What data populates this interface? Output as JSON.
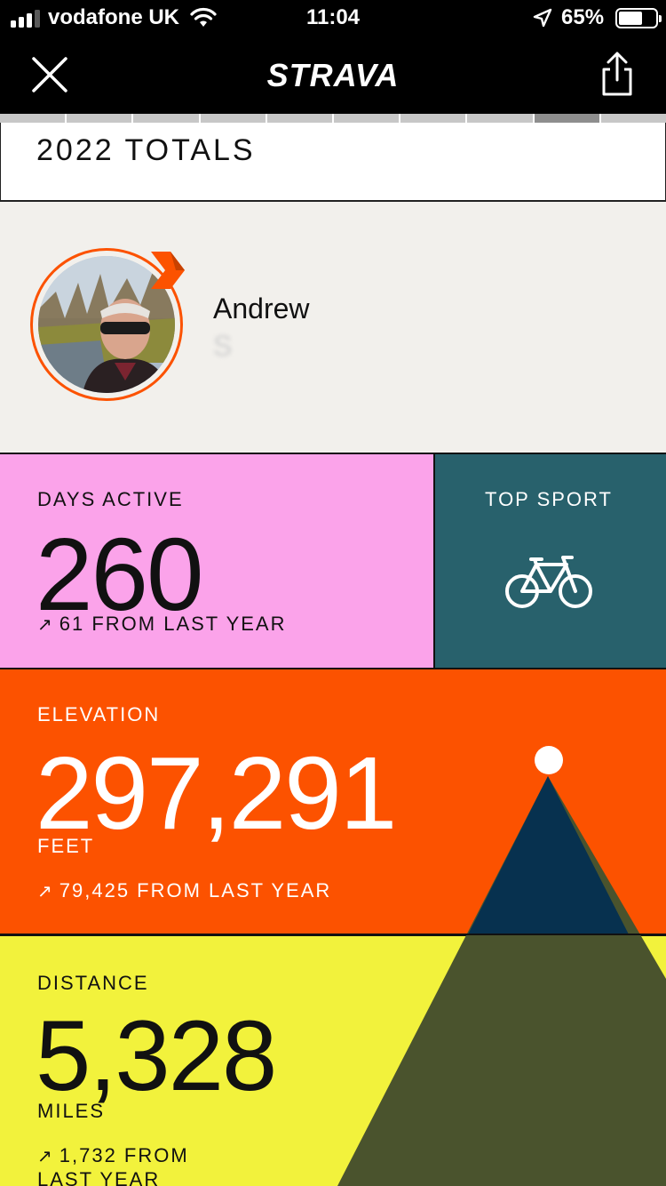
{
  "status_bar": {
    "carrier": "vodafone UK",
    "time": "11:04",
    "battery_percent": "65%",
    "battery_level": 0.65
  },
  "nav": {
    "logo": "STRAVA",
    "close_icon": "close-icon",
    "share_icon": "share-icon"
  },
  "story_progress": {
    "segments": 10,
    "current": 9
  },
  "card_title": "2022 TOTALS",
  "profile": {
    "first_name": "Andrew",
    "last_name_obscured": "S",
    "badge_color": "#fc5200"
  },
  "days_active": {
    "label": "DAYS ACTIVE",
    "value": "260",
    "delta": "61 FROM LAST YEAR",
    "arrow": "↗"
  },
  "top_sport": {
    "label": "TOP SPORT",
    "icon": "bicycle-icon"
  },
  "elevation": {
    "label": "ELEVATION",
    "value": "297,291",
    "unit": "FEET",
    "delta": "79,425 FROM LAST YEAR",
    "arrow": "↗"
  },
  "distance": {
    "label": "DISTANCE",
    "value": "5,328",
    "unit": "MILES",
    "delta": "1,732 FROM LAST YEAR",
    "arrow": "↗"
  },
  "colors": {
    "strava_orange": "#fc5200",
    "days_pink": "#fba3ea",
    "sport_teal": "#28616c",
    "distance_yellow": "#f2f23c",
    "mountain_navy": "#07314f",
    "mountain_olive": "#4a532d"
  }
}
